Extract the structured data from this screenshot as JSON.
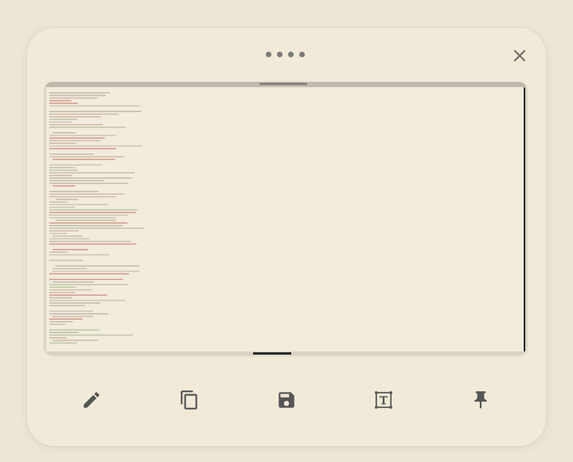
{
  "window": {
    "close_icon": "close-icon",
    "drag_handle_icon": "drag-handle-icon"
  },
  "preview": {
    "kind": "screenshot-thumbnail"
  },
  "toolbar": {
    "buttons": [
      {
        "name": "edit",
        "icon": "pencil-icon"
      },
      {
        "name": "copy",
        "icon": "copy-icon"
      },
      {
        "name": "save",
        "icon": "save-icon"
      },
      {
        "name": "extract-text",
        "icon": "text-recognition-icon"
      },
      {
        "name": "pin",
        "icon": "pin-icon"
      }
    ]
  },
  "colors": {
    "background": "#ece6d8",
    "panel": "#f1ead9",
    "icon": "#555555"
  }
}
